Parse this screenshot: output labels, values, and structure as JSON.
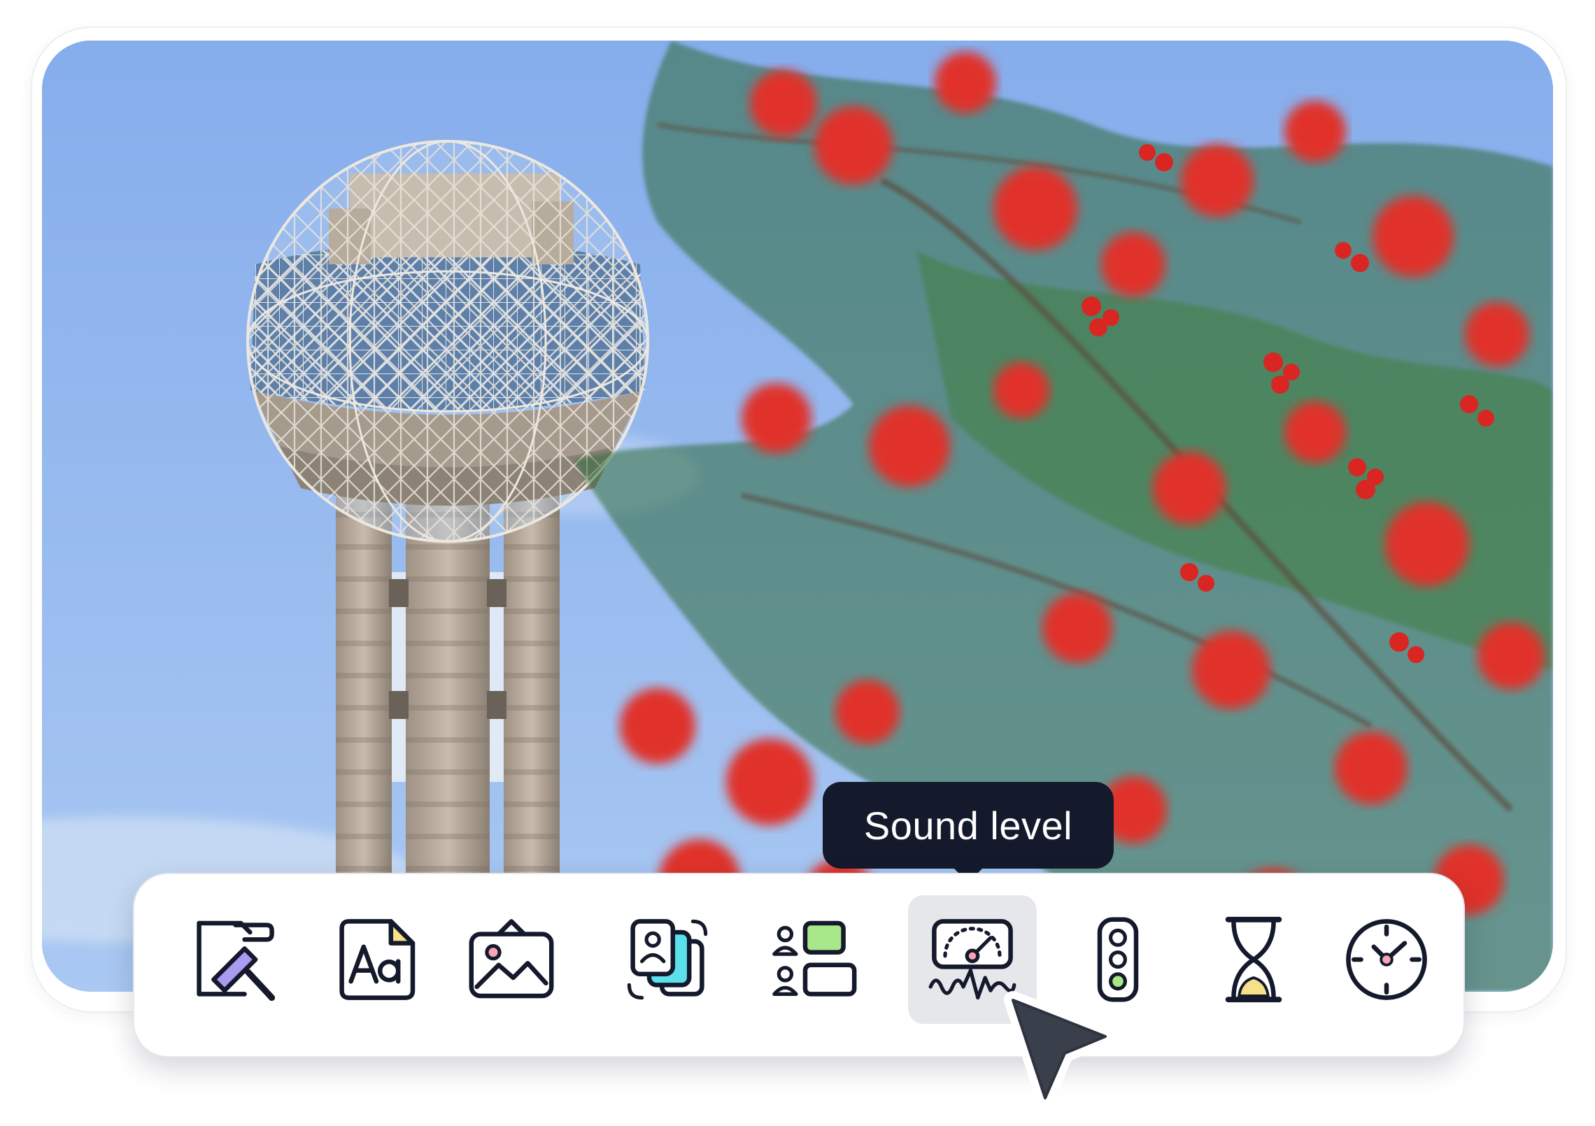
{
  "tooltip": {
    "text": "Sound level"
  },
  "toolbar": {
    "active_tool": "sound-level",
    "tools": [
      {
        "id": "edit-style",
        "icon": "paint-roller-icon"
      },
      {
        "id": "text",
        "icon": "text-aa-icon"
      },
      {
        "id": "image",
        "icon": "image-icon"
      },
      {
        "id": "media",
        "icon": "media-cards-icon"
      },
      {
        "id": "layout",
        "icon": "user-list-icon"
      },
      {
        "id": "sound-level",
        "icon": "sound-meter-icon"
      },
      {
        "id": "traffic-light",
        "icon": "traffic-light-icon"
      },
      {
        "id": "timer",
        "icon": "hourglass-icon"
      },
      {
        "id": "clock",
        "icon": "clock-icon"
      }
    ]
  },
  "colors": {
    "sky": "#8fb5ed",
    "tooltip_bg": "#141a2b",
    "icon_stroke": "#141a2b",
    "accent_purple": "#a99cf0",
    "accent_cyan": "#5ce0ec",
    "accent_green": "#a8e88a",
    "accent_yellow": "#f7e08a",
    "accent_pink": "#f7a3b5"
  }
}
